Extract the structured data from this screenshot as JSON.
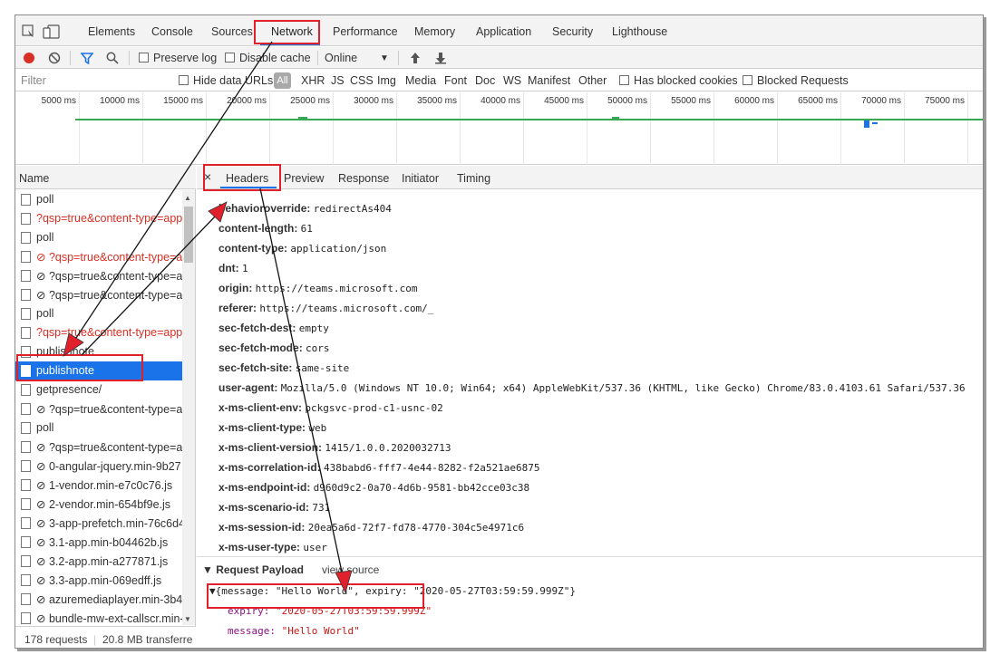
{
  "tabs": [
    "Elements",
    "Console",
    "Sources",
    "Network",
    "Performance",
    "Memory",
    "Application",
    "Security",
    "Lighthouse"
  ],
  "toolbar": {
    "preserve_log": "Preserve log",
    "disable_cache": "Disable cache",
    "throttling": "Online"
  },
  "filter": {
    "placeholder": "Filter",
    "hide_data_urls": "Hide data URLs",
    "all": "All",
    "types": [
      "XHR",
      "JS",
      "CSS",
      "Img",
      "Media",
      "Font",
      "Doc",
      "WS",
      "Manifest",
      "Other"
    ],
    "has_blocked_cookies": "Has blocked cookies",
    "blocked_requests": "Blocked Requests"
  },
  "timeline": {
    "ticks": [
      "5000 ms",
      "10000 ms",
      "15000 ms",
      "20000 ms",
      "25000 ms",
      "30000 ms",
      "35000 ms",
      "40000 ms",
      "45000 ms",
      "50000 ms",
      "55000 ms",
      "60000 ms",
      "65000 ms",
      "70000 ms",
      "75000 ms"
    ]
  },
  "requests": {
    "header": "Name",
    "items": [
      {
        "name": "poll",
        "error": false,
        "selected": false
      },
      {
        "name": "?qsp=true&content-type=app",
        "error": true,
        "selected": false
      },
      {
        "name": "poll",
        "error": false,
        "selected": false
      },
      {
        "name": "⊘ ?qsp=true&content-type=a",
        "error": true,
        "selected": false
      },
      {
        "name": "⊘ ?qsp=true&content-type=a",
        "error": false,
        "selected": false
      },
      {
        "name": "⊘ ?qsp=true&content-type=a",
        "error": false,
        "selected": false
      },
      {
        "name": "poll",
        "error": false,
        "selected": false
      },
      {
        "name": "?qsp=true&content-type=app",
        "error": true,
        "selected": false
      },
      {
        "name": "publishnote",
        "error": false,
        "selected": false
      },
      {
        "name": "publishnote",
        "error": false,
        "selected": true
      },
      {
        "name": "getpresence/",
        "error": false,
        "selected": false
      },
      {
        "name": "⊘ ?qsp=true&content-type=a",
        "error": false,
        "selected": false
      },
      {
        "name": "poll",
        "error": false,
        "selected": false
      },
      {
        "name": "⊘ ?qsp=true&content-type=a",
        "error": false,
        "selected": false
      },
      {
        "name": "⊘ 0-angular-jquery.min-9b27",
        "error": false,
        "selected": false
      },
      {
        "name": "⊘ 1-vendor.min-e7c0c76.js",
        "error": false,
        "selected": false
      },
      {
        "name": "⊘ 2-vendor.min-654bf9e.js",
        "error": false,
        "selected": false
      },
      {
        "name": "⊘ 3-app-prefetch.min-76c6d4",
        "error": false,
        "selected": false
      },
      {
        "name": "⊘ 3.1-app.min-b04462b.js",
        "error": false,
        "selected": false
      },
      {
        "name": "⊘ 3.2-app.min-a277871.js",
        "error": false,
        "selected": false
      },
      {
        "name": "⊘ 3.3-app.min-069edff.js",
        "error": false,
        "selected": false
      },
      {
        "name": "⊘ azuremediaplayer.min-3b40",
        "error": false,
        "selected": false
      },
      {
        "name": "⊘ bundle-mw-ext-callscr.min-",
        "error": false,
        "selected": false
      }
    ],
    "status_requests": "178 requests",
    "status_transferred": "20.8 MB transferre"
  },
  "detail": {
    "close": "×",
    "tabs": [
      "Headers",
      "Preview",
      "Response",
      "Initiator",
      "Timing"
    ],
    "headers": [
      {
        "key": "behavioroverride:",
        "value": "redirectAs404"
      },
      {
        "key": "content-length:",
        "value": "61"
      },
      {
        "key": "content-type:",
        "value": "application/json"
      },
      {
        "key": "dnt:",
        "value": "1"
      },
      {
        "key": "origin:",
        "value": "https://teams.microsoft.com"
      },
      {
        "key": "referer:",
        "value": "https://teams.microsoft.com/_"
      },
      {
        "key": "sec-fetch-dest:",
        "value": "empty"
      },
      {
        "key": "sec-fetch-mode:",
        "value": "cors"
      },
      {
        "key": "sec-fetch-site:",
        "value": "same-site"
      },
      {
        "key": "user-agent:",
        "value": "Mozilla/5.0 (Windows NT 10.0; Win64; x64) AppleWebKit/537.36 (KHTML, like Gecko) Chrome/83.0.4103.61 Safari/537.36"
      },
      {
        "key": "x-ms-client-env:",
        "value": "pckgsvc-prod-c1-usnc-02"
      },
      {
        "key": "x-ms-client-type:",
        "value": "web"
      },
      {
        "key": "x-ms-client-version:",
        "value": "1415/1.0.0.2020032713"
      },
      {
        "key": "x-ms-correlation-id:",
        "value": "438babd6-fff7-4e44-8282-f2a521ae6875"
      },
      {
        "key": "x-ms-endpoint-id:",
        "value": "d960d9c2-0a70-4d6b-9581-bb42cce03c38"
      },
      {
        "key": "x-ms-scenario-id:",
        "value": "731"
      },
      {
        "key": "x-ms-session-id:",
        "value": "20ea5a6d-72f7-fd78-4770-304c5e4971c6"
      },
      {
        "key": "x-ms-user-type:",
        "value": "user"
      }
    ],
    "payload": {
      "title": "▼ Request Payload",
      "view_source": "view source",
      "summary": "▼{message: \"Hello World\", expiry: \"2020-05-27T03:59:59.999Z\"}",
      "expiry_key": "expiry:",
      "expiry_value": "\"2020-05-27T03:59:59.999Z\"",
      "message_key": "message:",
      "message_value": "\"Hello World\""
    }
  },
  "colors": {
    "accent": "#1a73e8",
    "annotation_red": "#e0202a",
    "error_text": "#d93025"
  }
}
